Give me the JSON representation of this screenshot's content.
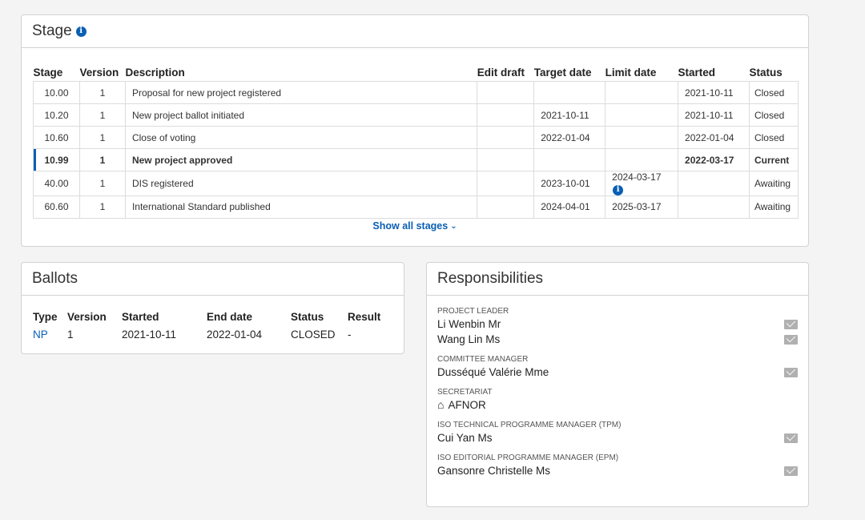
{
  "stage": {
    "title": "Stage",
    "columns": [
      "Stage",
      "Version",
      "Description",
      "Edit draft",
      "Target date",
      "Limit date",
      "Started",
      "Status"
    ],
    "rows": [
      {
        "stage": "10.00",
        "version": "1",
        "description": "Proposal for new project registered",
        "edit_draft": "",
        "target_date": "",
        "limit_date": "",
        "started": "2021-10-11",
        "status": "Closed"
      },
      {
        "stage": "10.20",
        "version": "1",
        "description": "New project ballot initiated",
        "edit_draft": "",
        "target_date": "2021-10-11",
        "limit_date": "",
        "started": "2021-10-11",
        "status": "Closed"
      },
      {
        "stage": "10.60",
        "version": "1",
        "description": "Close of voting",
        "edit_draft": "",
        "target_date": "2022-01-04",
        "limit_date": "",
        "started": "2022-01-04",
        "status": "Closed"
      },
      {
        "stage": "10.99",
        "version": "1",
        "description": "New project approved",
        "edit_draft": "",
        "target_date": "",
        "limit_date": "",
        "started": "2022-03-17",
        "status": "Current"
      },
      {
        "stage": "40.00",
        "version": "1",
        "description": "DIS registered",
        "edit_draft": "",
        "target_date": "2023-10-01",
        "limit_date": "2024-03-17",
        "started": "",
        "status": "Awaiting"
      },
      {
        "stage": "60.60",
        "version": "1",
        "description": "International Standard published",
        "edit_draft": "",
        "target_date": "2024-04-01",
        "limit_date": "2025-03-17",
        "started": "",
        "status": "Awaiting"
      }
    ],
    "show_all_label": "Show all stages"
  },
  "ballots": {
    "title": "Ballots",
    "columns": [
      "Type",
      "Version",
      "Started",
      "End date",
      "Status",
      "Result"
    ],
    "rows": [
      {
        "type": "NP",
        "version": "1",
        "started": "2021-10-11",
        "end_date": "2022-01-04",
        "status": "CLOSED",
        "result": "-"
      }
    ]
  },
  "responsibilities": {
    "title": "Responsibilities",
    "groups": [
      {
        "role": "PROJECT LEADER",
        "people": [
          "Li Wenbin Mr",
          "Wang Lin Ms"
        ]
      },
      {
        "role": "COMMITTEE MANAGER",
        "people": [
          "Dusséqué Valérie Mme"
        ]
      },
      {
        "role": "SECRETARIAT",
        "people": [
          "AFNOR"
        ]
      },
      {
        "role": "ISO TECHNICAL PROGRAMME MANAGER (TPM)",
        "people": [
          "Cui Yan Ms"
        ]
      },
      {
        "role": "ISO EDITORIAL PROGRAMME MANAGER (EPM)",
        "people": [
          "Gansonre Christelle Ms"
        ]
      }
    ]
  },
  "icons": {
    "info": "info-circle-icon",
    "mail": "envelope-icon",
    "home": "home-icon",
    "chevron": "chevron-down-icon"
  },
  "colors": {
    "accent": "#0a5fb4"
  }
}
